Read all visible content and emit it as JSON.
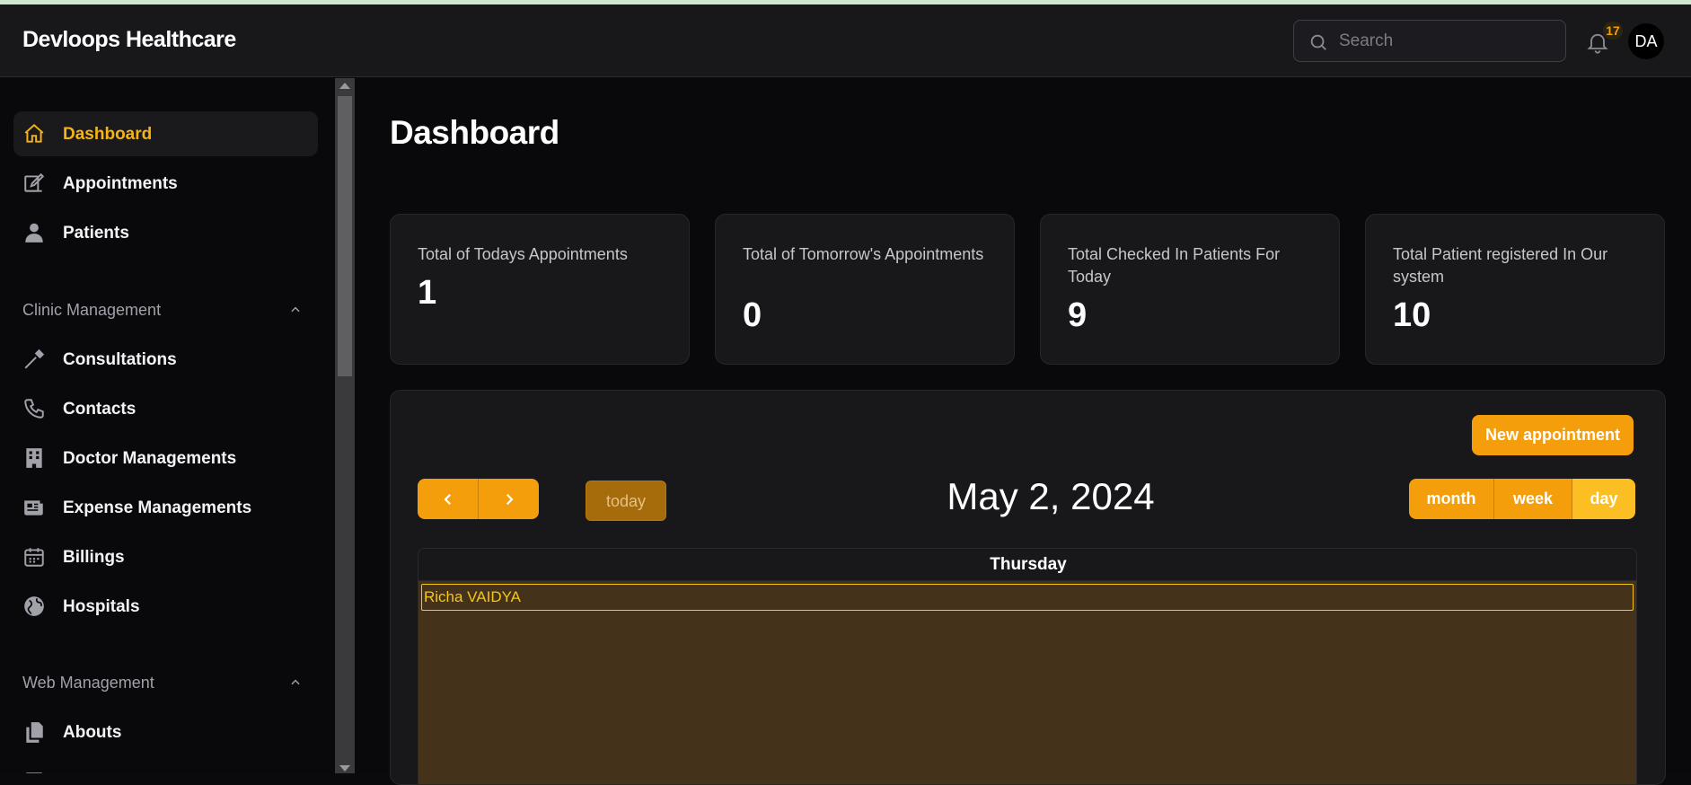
{
  "header": {
    "brand": "Devloops Healthcare",
    "search_placeholder": "Search",
    "notification_count": "17",
    "avatar_initials": "DA"
  },
  "sidebar": {
    "items_top": [
      {
        "label": "Dashboard",
        "icon": "home-icon",
        "active": true
      },
      {
        "label": "Appointments",
        "icon": "edit-icon"
      },
      {
        "label": "Patients",
        "icon": "user-icon"
      }
    ],
    "section_clinic": "Clinic Management",
    "items_clinic": [
      {
        "label": "Consultations",
        "icon": "pipette-icon"
      },
      {
        "label": "Contacts",
        "icon": "phone-icon"
      },
      {
        "label": "Doctor Managements",
        "icon": "building-icon"
      },
      {
        "label": "Expense Managements",
        "icon": "newspaper-icon"
      },
      {
        "label": "Billings",
        "icon": "calendar-icon"
      },
      {
        "label": "Hospitals",
        "icon": "globe-icon"
      }
    ],
    "section_web": "Web Management",
    "items_web": [
      {
        "label": "Abouts",
        "icon": "files-icon"
      }
    ]
  },
  "main": {
    "title": "Dashboard",
    "cards": [
      {
        "title": "Total of Todays Appointments",
        "value": "1"
      },
      {
        "title": "Total of Tomorrow's Appointments",
        "value": "0"
      },
      {
        "title": "Total Checked In Patients For Today",
        "value": "9"
      },
      {
        "title": "Total Patient registered In Our system",
        "value": "10"
      }
    ],
    "calendar": {
      "new_button": "New appointment",
      "today_button": "today",
      "date_title": "May 2, 2024",
      "views": [
        "month",
        "week",
        "day"
      ],
      "active_view": "day",
      "day_header": "Thursday",
      "events": [
        "Richa VAIDYA"
      ]
    }
  },
  "colors": {
    "accent": "#f59e0b",
    "active_nav_text": "#f5b316",
    "event_bg": "#45321a",
    "event_border": "#f5c518"
  }
}
